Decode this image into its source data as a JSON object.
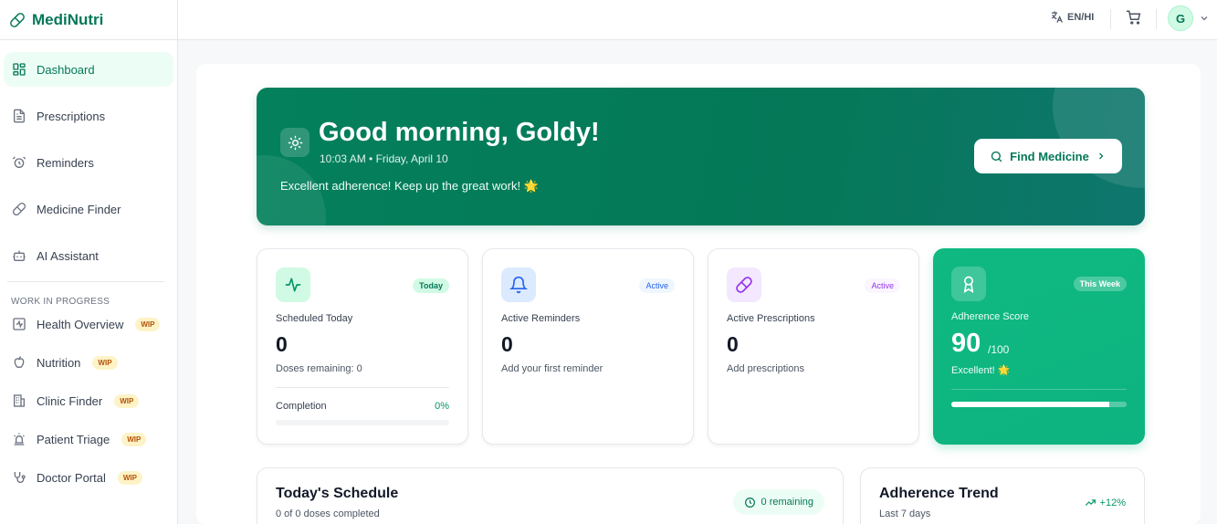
{
  "brand": {
    "name": "MediNutri",
    "icon": "pill-icon"
  },
  "nav": {
    "items": [
      {
        "label": "Dashboard",
        "icon": "grid-icon",
        "active": true
      },
      {
        "label": "Prescriptions",
        "icon": "file-icon"
      },
      {
        "label": "Reminders",
        "icon": "alarm-icon"
      },
      {
        "label": "Medicine Finder",
        "icon": "pill-icon"
      },
      {
        "label": "AI Assistant",
        "icon": "bot-icon"
      }
    ],
    "section_label": "WORK IN PROGRESS",
    "wip_badge": "WIP",
    "wip_items": [
      {
        "label": "Health Overview",
        "icon": "activity-icon"
      },
      {
        "label": "Nutrition",
        "icon": "apple-icon"
      },
      {
        "label": "Clinic Finder",
        "icon": "building-icon"
      },
      {
        "label": "Patient Triage",
        "icon": "siren-icon"
      },
      {
        "label": "Doctor Portal",
        "icon": "stethoscope-icon"
      }
    ]
  },
  "topbar": {
    "language": "EN/HI",
    "avatar_initial": "G"
  },
  "hero": {
    "title": "Good morning, Goldy!",
    "subtitle": "10:03 AM • Friday, April 10",
    "message": "Excellent adherence! Keep up the great work! 🌟",
    "button": "Find Medicine"
  },
  "stats": {
    "scheduled": {
      "tag": "Today",
      "label": "Scheduled Today",
      "value": "0",
      "note": "Doses remaining: 0",
      "completion_label": "Completion",
      "completion_value": "0%",
      "completion_fraction": 0
    },
    "reminders": {
      "tag": "Active",
      "label": "Active Reminders",
      "value": "0",
      "note": "Add your first reminder"
    },
    "prescriptions": {
      "tag": "Active",
      "label": "Active Prescriptions",
      "value": "0",
      "note": "Add prescriptions"
    },
    "adherence": {
      "tag": "This Week",
      "label": "Adherence Score",
      "value": "90",
      "denominator": "/100",
      "note": "Excellent! 🌟",
      "fraction": 0.9
    }
  },
  "schedule": {
    "title": "Today's Schedule",
    "subtitle": "0 of 0 doses completed",
    "remaining": "0 remaining"
  },
  "trend": {
    "title": "Adherence Trend",
    "subtitle": "Last 7 days",
    "change": "+12%"
  },
  "colors": {
    "brand": "#047857",
    "accent": "#10b981",
    "wip": "#fef3c7"
  }
}
